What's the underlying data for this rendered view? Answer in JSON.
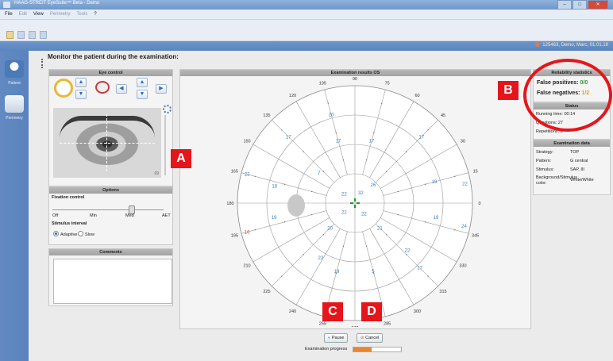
{
  "window": {
    "title": "HAAG-STREIT EyeSuite™  Beta  -  Demo"
  },
  "menu": {
    "items": [
      "File",
      "Edit",
      "View",
      "Perimetry",
      "Tools",
      "?"
    ],
    "dim": [
      false,
      true,
      false,
      true,
      true,
      false
    ]
  },
  "patient": {
    "info": "125463, Demo, Marc, 01.01.19"
  },
  "nav": {
    "patient_label": "Patient",
    "perimetry_label": "Perimetry"
  },
  "page": {
    "title": "Monitor the patient during the examination:"
  },
  "eye_control": {
    "header": "Eye control",
    "image_value": "69"
  },
  "options": {
    "header": "Options",
    "fixation_label": "Fixation control",
    "ticks": [
      "Off",
      "Min",
      "Med",
      "AET"
    ],
    "stimulus_interval_label": "Stimulus interval",
    "adaptive_label": "Adaptive",
    "slow_label": "Slow"
  },
  "comments": {
    "header": "Comments"
  },
  "exam": {
    "header": "Examination results OS",
    "angles": [
      "90",
      "75",
      "60",
      "45",
      "30",
      "15",
      "0",
      "345",
      "330",
      "315",
      "300",
      "285",
      "270",
      "255",
      "240",
      "225",
      "210",
      "195",
      "180",
      "165",
      "150",
      "135",
      "120",
      "105"
    ],
    "values": [
      {
        "v": "20",
        "c": "#3a7cc2",
        "a": 105,
        "r": 0.78
      },
      {
        "v": "17",
        "c": "#3a7cc2",
        "a": 135,
        "r": 0.8
      },
      {
        "v": "17",
        "c": "#3a7cc2",
        "a": 105,
        "r": 0.55
      },
      {
        "v": "17",
        "c": "#3a7cc2",
        "a": 75,
        "r": 0.55
      },
      {
        "v": "17",
        "c": "#3a7cc2",
        "a": 45,
        "r": 0.8
      },
      {
        "v": "22",
        "c": "#3a7cc2",
        "a": 165,
        "r": 0.95
      },
      {
        "v": "18",
        "c": "#3a7cc2",
        "a": 168,
        "r": 0.7
      },
      {
        "v": "7",
        "c": "#3a7cc2",
        "a": 140,
        "r": 0.4
      },
      {
        "v": "26",
        "c": "#3a7cc2",
        "a": 45,
        "r": 0.22
      },
      {
        "v": "19",
        "c": "#3a7cc2",
        "a": 15,
        "r": 0.7
      },
      {
        "v": "22",
        "c": "#3a7cc2",
        "a": 10,
        "r": 0.95
      },
      {
        "v": "22",
        "c": "#3a7cc2",
        "a": 140,
        "r": 0.12
      },
      {
        "v": "32",
        "c": "#3a7cc2",
        "a": 60,
        "r": 0.1
      },
      {
        "v": "22",
        "c": "#3a7cc2",
        "a": 220,
        "r": 0.12
      },
      {
        "v": "22",
        "c": "#3a7cc2",
        "a": 310,
        "r": 0.12
      },
      {
        "v": "19",
        "c": "#3a7cc2",
        "a": 190,
        "r": 0.7
      },
      {
        "v": "16",
        "c": "#e03a3a",
        "a": 195,
        "r": 0.95
      },
      {
        "v": "19",
        "c": "#3a7cc2",
        "a": 350,
        "r": 0.7
      },
      {
        "v": "24",
        "c": "#3a7cc2",
        "a": 348,
        "r": 0.95
      },
      {
        "v": "20",
        "c": "#3a7cc2",
        "a": 225,
        "r": 0.3
      },
      {
        "v": "21",
        "c": "#3a7cc2",
        "a": 315,
        "r": 0.3
      },
      {
        "v": "22",
        "c": "#3a7cc2",
        "a": 238,
        "r": 0.55
      },
      {
        "v": "22",
        "c": "#3a7cc2",
        "a": 318,
        "r": 0.6
      },
      {
        "v": "19",
        "c": "#3a7cc2",
        "a": 255,
        "r": 0.6
      },
      {
        "v": "5",
        "c": "#3a7cc2",
        "a": 285,
        "r": 0.6
      },
      {
        "v": "17",
        "c": "#3a7cc2",
        "a": 315,
        "r": 0.78
      }
    ]
  },
  "reliability": {
    "header": "Reliability statistics",
    "fp_label": "False positives:",
    "fp_value": "0/0",
    "fp_color": "#2e9a2e",
    "fn_label": "False negatives:",
    "fn_value": "1/2",
    "fn_color": "#e59b2b"
  },
  "status": {
    "header": "Status",
    "running_label": "Running time:",
    "running_value": "00:14",
    "questions_label": "Questions:",
    "questions_value": "27",
    "repetitions_label": "Repetitions:",
    "repetitions_value": "0"
  },
  "exam_data": {
    "header": "Examination data",
    "rows": [
      {
        "label": "Strategy:",
        "value": "TOP"
      },
      {
        "label": "Pattern:",
        "value": "G central"
      },
      {
        "label": "Stimulus:",
        "value": "SAP, III"
      },
      {
        "label": "Background/Stimulus color:",
        "value": "White/White"
      }
    ]
  },
  "buttons": {
    "pause": "Pause",
    "cancel": "Cancel"
  },
  "progress": {
    "label": "Examination progress",
    "value": 0.38
  },
  "markers": {
    "a": "A",
    "b": "B",
    "c": "C",
    "d": "D"
  }
}
